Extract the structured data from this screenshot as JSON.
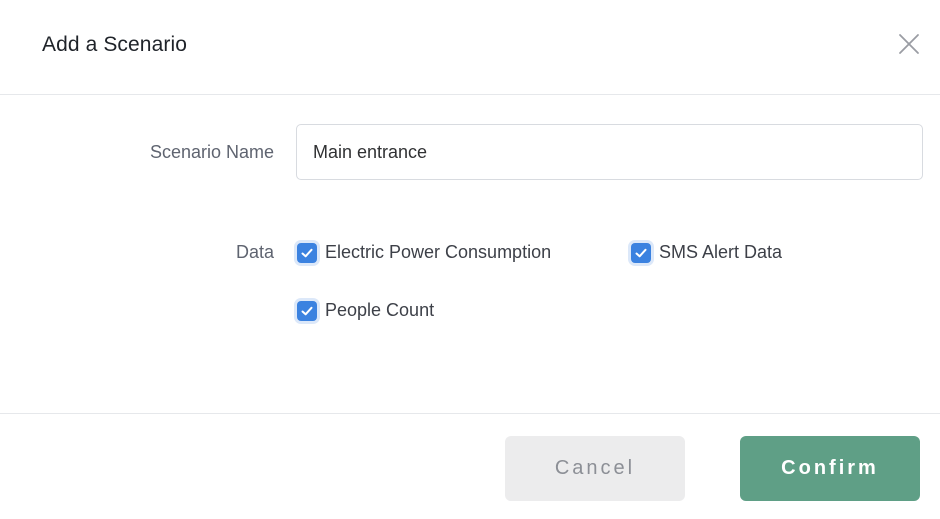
{
  "dialog": {
    "title": "Add a Scenario",
    "close_icon": "close-icon"
  },
  "form": {
    "scenario_name_label": "Scenario Name",
    "scenario_name_value": "Main entrance",
    "data_label": "Data",
    "data_options": [
      {
        "label": "Electric Power Consumption",
        "checked": true
      },
      {
        "label": "SMS Alert Data",
        "checked": true
      },
      {
        "label": "People Count",
        "checked": true
      }
    ]
  },
  "footer": {
    "cancel_label": "Cancel",
    "confirm_label": "Confirm"
  },
  "colors": {
    "checkbox_accent": "#3b82e0",
    "confirm_button": "#5f9f86",
    "cancel_button": "#ececed"
  }
}
